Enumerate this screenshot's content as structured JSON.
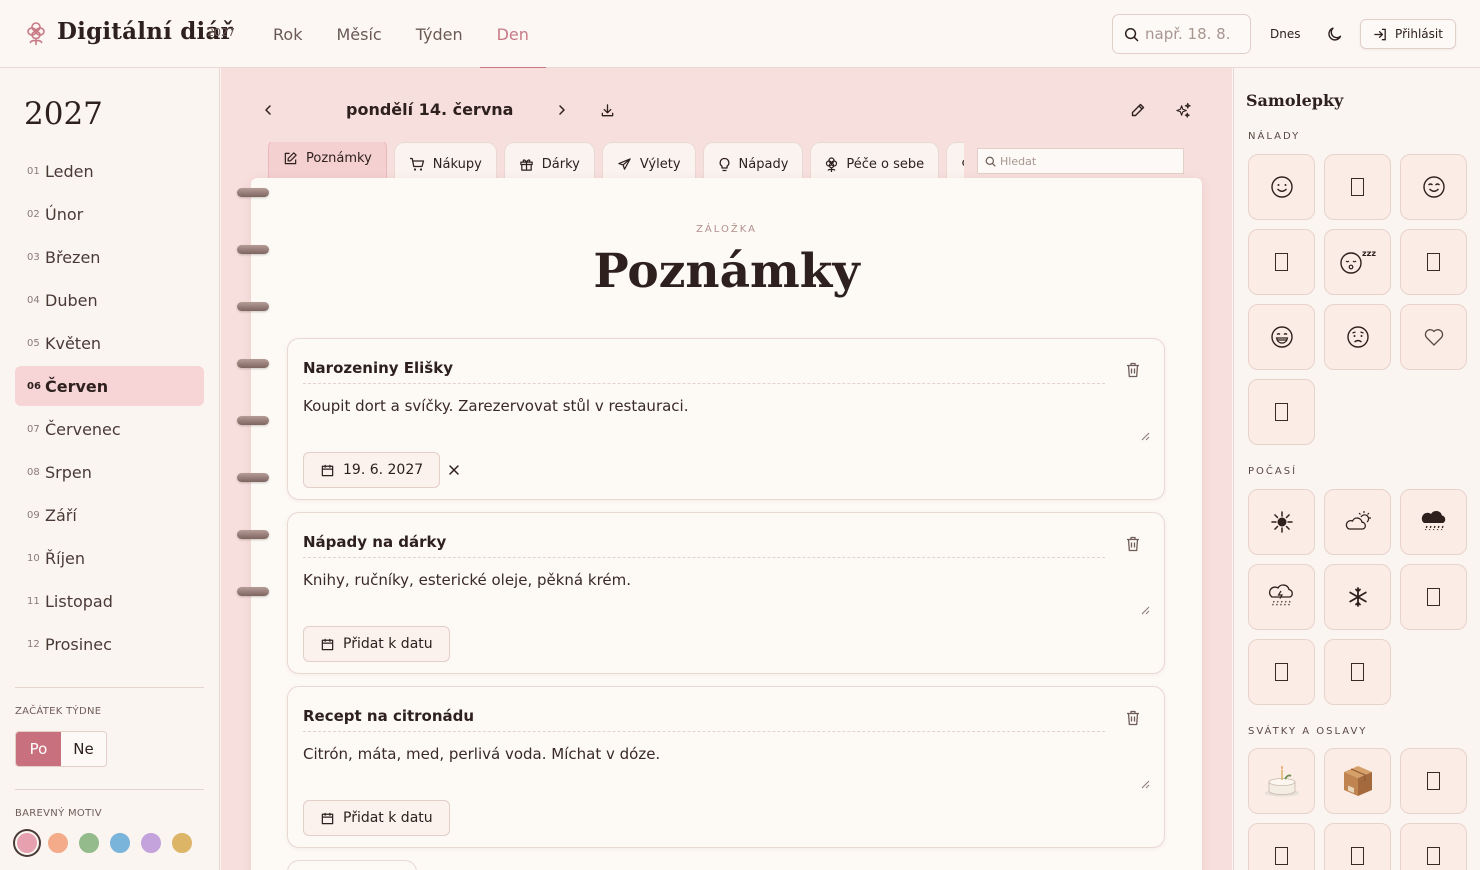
{
  "header": {
    "logo_text": "Digitální diář",
    "logo_year": "2027",
    "nav": [
      "Rok",
      "Měsíc",
      "Týden",
      "Den"
    ],
    "nav_active": "Den",
    "search_placeholder": "např. 18. 8.",
    "today_label": "Dnes",
    "login_label": "Přihlásit"
  },
  "sidebar": {
    "year": "2027",
    "months": [
      {
        "num": "01",
        "name": "Leden"
      },
      {
        "num": "02",
        "name": "Únor"
      },
      {
        "num": "03",
        "name": "Březen"
      },
      {
        "num": "04",
        "name": "Duben"
      },
      {
        "num": "05",
        "name": "Květen"
      },
      {
        "num": "06",
        "name": "Červen"
      },
      {
        "num": "07",
        "name": "Červenec"
      },
      {
        "num": "08",
        "name": "Srpen"
      },
      {
        "num": "09",
        "name": "Září"
      },
      {
        "num": "10",
        "name": "Říjen"
      },
      {
        "num": "11",
        "name": "Listopad"
      },
      {
        "num": "12",
        "name": "Prosinec"
      }
    ],
    "active_month": "Červen",
    "week_start_label": "ZAČÁTEK TÝDNE",
    "week_options": [
      "Po",
      "Ne"
    ],
    "week_active": "Po",
    "theme_label": "BAREVNÝ MOTIV",
    "theme_colors": [
      "#e7a0ae",
      "#f4ab8a",
      "#93bb8b",
      "#7ab4da",
      "#c4a3dc",
      "#dcb567"
    ],
    "theme_active": "#e7a0ae"
  },
  "main": {
    "day_title": "pondělí 14. června",
    "tabs": [
      "Poznámky",
      "Nákupy",
      "Dárky",
      "Výlety",
      "Nápady",
      "Péče o sebe"
    ],
    "tab_icons": [
      "note-edit-icon",
      "cart-icon",
      "gift-icon",
      "plane-icon",
      "lightbulb-icon",
      "flower-icon",
      "heart-icon"
    ],
    "active_tab": "Poznámky",
    "tab_search_placeholder": "Hledat",
    "section_label": "ZÁLOŽKA",
    "section_title": "Poznámky",
    "notes": [
      {
        "title": "Narozeniny Elišky",
        "body": "Koupit dort a svíčky. Zarezervovat stůl v restauraci.",
        "date": "19. 6. 2027"
      },
      {
        "title": "Nápady na dárky",
        "body": "Knihy, ručníky, esterické oleje, pěkná krém.",
        "date_button": "Přidat k datu"
      },
      {
        "title": "Recept na citronádu",
        "body": "Citrón, máta, med, perlivá voda. Míchat v dóze.",
        "date_button": "Přidat k datu"
      }
    ]
  },
  "stickers": {
    "title": "Samolepky",
    "categories": [
      {
        "label": "NÁLADY",
        "items": [
          "☺",
          "□",
          "☺",
          "□",
          "😴",
          "□",
          "😄",
          "☹",
          "♡",
          "□"
        ]
      },
      {
        "label": "POČASÍ",
        "items": [
          "☀",
          "⛅",
          "🌧",
          "⛈",
          "❄",
          "□",
          "□",
          "□"
        ]
      },
      {
        "label": "SVÁTKY A OSLAVY",
        "items": [
          "🎂",
          "📦",
          "□",
          "□",
          "□",
          "□"
        ]
      }
    ]
  }
}
